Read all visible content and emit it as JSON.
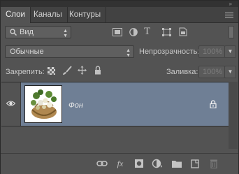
{
  "tabs": [
    {
      "label": "Слои",
      "active": true
    },
    {
      "label": "Каналы",
      "active": false
    },
    {
      "label": "Контуры",
      "active": false
    }
  ],
  "filter": {
    "kind_label": "Вид",
    "icons": [
      "pixel-filter-icon",
      "adjustment-filter-icon",
      "type-filter-icon",
      "shape-filter-icon",
      "smart-object-filter-icon"
    ]
  },
  "blend": {
    "mode": "Обычные",
    "opacity_label": "Непрозрачность:",
    "opacity_value": "100%"
  },
  "lock": {
    "label": "Закрепить:",
    "icons": [
      "lock-transparent-icon",
      "lock-image-icon",
      "lock-position-icon",
      "lock-all-icon"
    ],
    "fill_label": "Заливка:",
    "fill_value": "100%"
  },
  "layers": [
    {
      "name": "Фон",
      "visible": true,
      "locked": true
    }
  ],
  "bottom_icons": [
    "link-layers-icon",
    "layer-style-icon",
    "add-mask-icon",
    "adjustment-layer-icon",
    "new-group-icon",
    "new-layer-icon",
    "delete-layer-icon"
  ],
  "colors": {
    "panel_bg": "#535353",
    "selected_layer": "#6f7f95",
    "tab_bar": "#424242"
  }
}
